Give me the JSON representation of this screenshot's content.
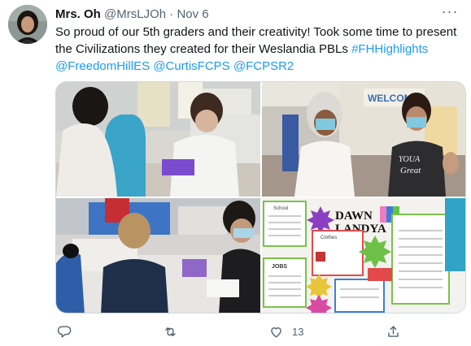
{
  "author": {
    "name": "Mrs. Oh",
    "handle": "@MrsLJOh",
    "dot": "·",
    "time": "Nov 6"
  },
  "more_label": "···",
  "tweet": {
    "text": "So proud of our 5th graders and their creativity!  Took some time to present the Civilizations they created for their Weslandia PBLs ",
    "hashtag": "#FHHighlights",
    "space": " ",
    "mentions": [
      "@FreedomHillES",
      "@CurtisFCPS",
      "@FCPSR2"
    ]
  },
  "media": {
    "photo_texts": {
      "welcome_banner": "WELCOM",
      "shirt_text_1": "YOUA",
      "shirt_text_2": "Great",
      "poster_title_1": "DAWN",
      "poster_title_2": "LANDYA",
      "poster_label_school": "School",
      "poster_label_clothes": "Clothes",
      "poster_label_jobs": "JOBS"
    }
  },
  "actions": {
    "reply": {
      "icon": "reply-icon",
      "count": ""
    },
    "retweet": {
      "icon": "retweet-icon",
      "count": ""
    },
    "like": {
      "icon": "heart-icon",
      "count": "13"
    },
    "share": {
      "icon": "share-icon"
    }
  },
  "colors": {
    "link": "#1d9bf0",
    "secondary_text": "#536471",
    "primary_text": "#0f1419"
  }
}
